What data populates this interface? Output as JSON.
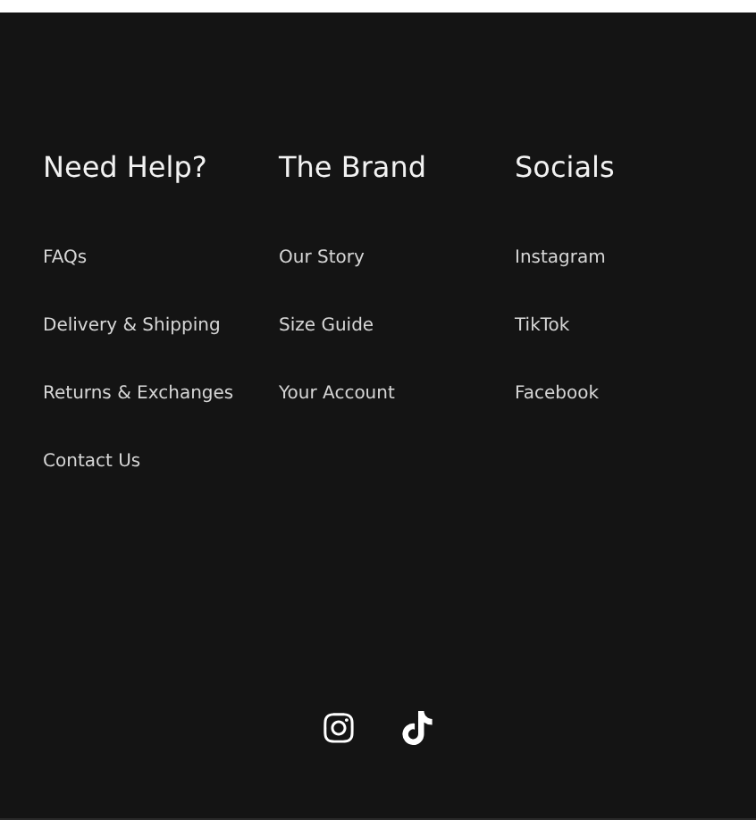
{
  "columns": [
    {
      "heading": "Need Help?",
      "links": [
        "FAQs",
        "Delivery & Shipping",
        "Returns & Exchanges",
        "Contact Us"
      ]
    },
    {
      "heading": "The Brand",
      "links": [
        "Our Story",
        "Size Guide",
        "Your Account"
      ]
    },
    {
      "heading": "Socials",
      "links": [
        "Instagram",
        "TikTok",
        "Facebook"
      ]
    }
  ],
  "social_icons": [
    {
      "kind": "instagram"
    },
    {
      "kind": "tiktok"
    }
  ]
}
